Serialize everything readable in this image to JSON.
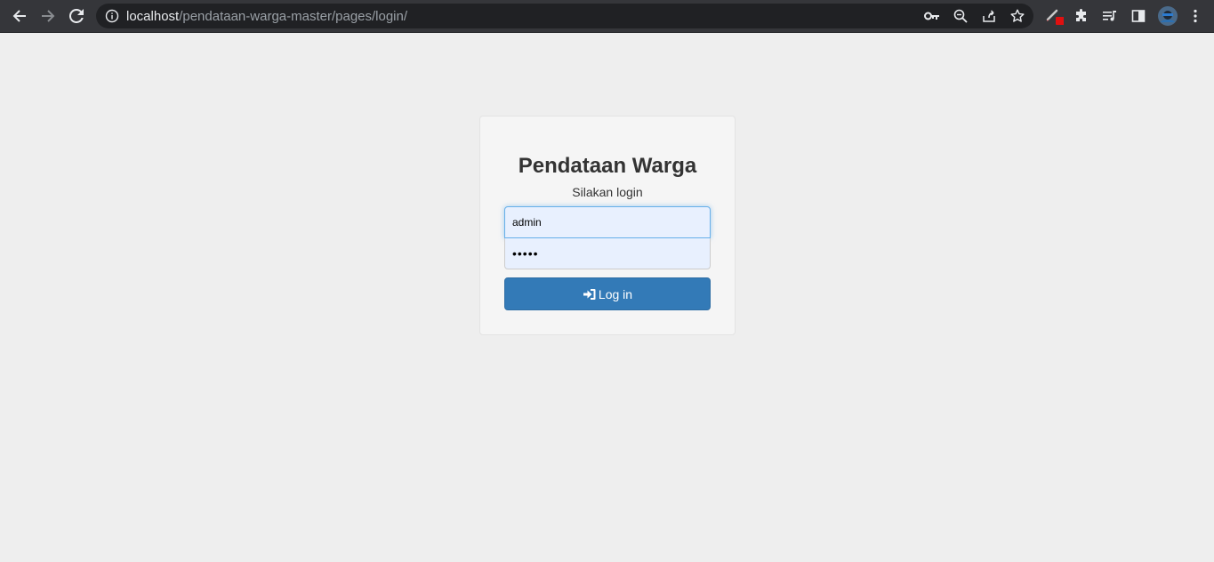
{
  "browser": {
    "url_host": "localhost",
    "url_path": "/pendataan-warga-master/pages/login/",
    "icons": [
      "back-icon",
      "forward-icon",
      "reload-icon",
      "info-icon",
      "key-icon",
      "zoom-icon",
      "share-icon",
      "star-icon",
      "extension-pen-icon",
      "puzzle-icon",
      "media-queue-icon",
      "side-panel-icon",
      "profile-avatar",
      "menu-icon"
    ]
  },
  "login": {
    "title": "Pendataan Warga",
    "subtitle": "Silakan login",
    "username_value": "admin",
    "password_value": "admin",
    "button_label": "Log in",
    "button_icon": "sign-in-icon"
  },
  "colors": {
    "primary": "#337ab7",
    "page_bg": "#eeeeee",
    "panel_bg": "#f5f5f5",
    "toolbar_bg": "#35363a"
  }
}
